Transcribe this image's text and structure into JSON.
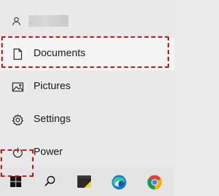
{
  "start_menu": {
    "user": {
      "icon": "user-icon"
    },
    "items": [
      {
        "label": "Documents",
        "icon": "document-icon"
      },
      {
        "label": "Pictures",
        "icon": "pictures-icon"
      },
      {
        "label": "Settings",
        "icon": "gear-icon"
      },
      {
        "label": "Power",
        "icon": "power-icon"
      }
    ]
  },
  "taskbar": {
    "buttons": [
      {
        "icon": "windows-start-icon"
      },
      {
        "icon": "search-icon"
      },
      {
        "icon": "file-explorer-icon"
      },
      {
        "icon": "edge-browser-icon"
      },
      {
        "icon": "chrome-browser-icon"
      }
    ]
  },
  "colors": {
    "highlight": "#e00000",
    "menu_bg": "#e9e9e9",
    "selected_bg": "#f4f4f4"
  }
}
